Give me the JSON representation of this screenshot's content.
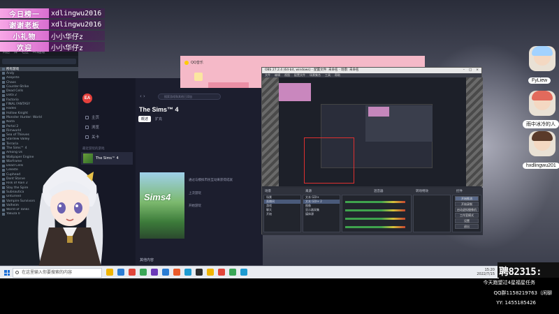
{
  "overlay": {
    "ranks": [
      {
        "label": "今日榜一",
        "value": "xdlingwu2016"
      },
      {
        "label": "谢谢老板",
        "value": "xdlingwu2016"
      },
      {
        "label": "小礼物",
        "value": "小小华仔z"
      },
      {
        "label": "欢迎",
        "value": "小小华仔z"
      }
    ],
    "cam_names": [
      "FyLiew",
      "雨中冰冷的人",
      "hxdlingwu201"
    ],
    "counter": "聘82315:",
    "info_lines": [
      "今天跑望过4星福星任务",
      "QQ群1158219763（闲聊",
      "YY:   1455185426"
    ]
  },
  "ea": {
    "logo": "EA",
    "nav": [
      "主页",
      "浏览",
      "关卡"
    ],
    "recent_label": "最近游玩的游戏",
    "recent_item": "The Sims™ 4",
    "search_placeholder": "搜索游戏和其他已添加",
    "game_title": "The Sims™ 4",
    "tabs": [
      "概述",
      "扩充"
    ],
    "cover_text": "Sims4",
    "info": [
      "通过与模拟市民互动来获得成就",
      "上次游玩",
      "开始游玩"
    ],
    "bottom": "其他内容"
  },
  "qq": {
    "title": "QQ音乐"
  },
  "obs": {
    "title": "OBS 27.2.4 (64-bit, windows) - 配置文件: 未命名 - 场景: 未命名",
    "menu": [
      "文件",
      "编辑",
      "视图",
      "配置文件",
      "场景集合",
      "工具",
      "帮助"
    ],
    "docks": [
      "场景",
      "来源",
      "混音器",
      "转场特效",
      "控件"
    ],
    "scenes": [
      "场景",
      "直播间",
      "游戏",
      "聊天",
      "开始"
    ],
    "sources": [
      "文本 GDI+",
      "文本 GDI+ 2",
      "图像",
      "显示器采集",
      "媒体源"
    ],
    "controls": [
      "开始推流",
      "开始录制",
      "启动虚拟摄像机",
      "工作室模式",
      "设置",
      "退出"
    ],
    "status": "LIVE: 00:00:00  REC: 00:00:00  CPU: 2.1%, 30.00 fps"
  },
  "steam": {
    "tabs": [
      "商店",
      "库",
      "社区",
      "MS超级"
    ],
    "games": [
      "所有游戏",
      "Andy",
      "Aseprite",
      "Chaos",
      "Counter-Strike",
      "Dead Cells",
      "Dota 2",
      "Factorio",
      "FINAL FANTASY",
      "Hades",
      "Hollow Knight",
      "Monster Hunter: World",
      "Noita",
      "Portal 2",
      "Rimworld",
      "Sea of Thieves",
      "Stardew Valley",
      "Terraria",
      "The Sims™ 4",
      "Among Us",
      "Wallpaper Engine",
      "Warframe",
      "Dead Cells",
      "Celeste",
      "Cuphead",
      "Dont Starve",
      "Risk of Rain 2",
      "Slay the Spire",
      "Subnautica",
      "Unturned",
      "Vampire Survivors",
      "Valheim",
      "World of Tanks",
      "Yakuza 0"
    ]
  },
  "taskbar": {
    "search_placeholder": "在这里输入你要搜索的内容",
    "tray": [
      "15:20",
      "2022/7/15"
    ],
    "icon_colors": [
      "#f0b400",
      "#2b7cd3",
      "#e0453a",
      "#3aa657",
      "#6b3ab8",
      "#2b7cd3",
      "#ea5a2a",
      "#1d9bd1",
      "#2d2d2d",
      "#f0b400",
      "#e0453a",
      "#3aa657",
      "#1d9bd1"
    ]
  }
}
